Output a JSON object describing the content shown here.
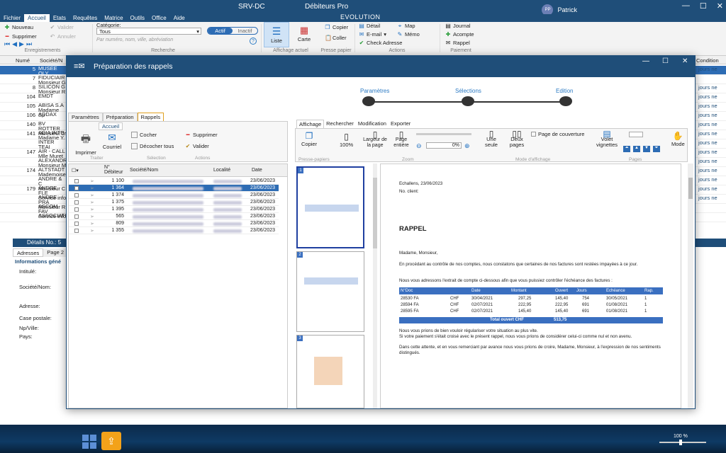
{
  "window": {
    "server": "SRV-DC",
    "app_title": "Débiteurs Pro",
    "subtitle": "EVOLUTION",
    "user_initials": "PP",
    "user_name": "Patrick"
  },
  "menu": [
    "Fichier",
    "Accueil",
    "Etats",
    "Requêtes",
    "Matrice",
    "Outils",
    "Office",
    "Aide"
  ],
  "ribbon": {
    "nouveau": "Nouveau",
    "valider": "Valider",
    "supprimer": "Supprimer",
    "annuler": "Annuler",
    "categorie_label": "Catégorie:",
    "categorie_value": "Tous",
    "search_placeholder": "Par numéro, nom, ville, abréviation",
    "actif": "Actif",
    "inactif": "Inactif",
    "liste": "Liste",
    "carte": "Carte",
    "copier": "Copier",
    "coller": "Coller",
    "detail": "Détail",
    "email": "E-mail",
    "check": "Check Adresse",
    "map": "Map",
    "memo": "Mémo",
    "journal": "Journal",
    "acompte": "Acompte",
    "rappel": "Rappel",
    "groups": {
      "enregistrements": "Enregistrements",
      "recherche": "Recherche",
      "affichage": "Affichage actuel",
      "presse": "Presse papier",
      "actions": "Actions",
      "paiement": "Paiement"
    }
  },
  "grid": {
    "col_num": "Numé",
    "col_soc": "Société/N",
    "col_cond": "Condition",
    "rows": [
      {
        "n": "5",
        "s1": "MUSEE OLY",
        "s2": "Monsieur B",
        "c": "jours ne"
      },
      {
        "n": "7",
        "s1": "FIDUCIAIR",
        "s2": "Monsieur G",
        "c": ""
      },
      {
        "n": "8",
        "s1": "SILICON G",
        "s2": "Monsieur R",
        "c": "jours ne"
      },
      {
        "n": "104",
        "s1": "EMDT",
        "s2": "",
        "c": "jours ne"
      },
      {
        "n": "105",
        "s1": "ABISA S.A",
        "s2": "Madame Sp",
        "c": "jours ne"
      },
      {
        "n": "106",
        "s1": "ADDAX",
        "s2": "",
        "c": "jours ne"
      },
      {
        "n": "140",
        "s1": "BV ROTTER",
        "s2": "Monsieur Jr",
        "c": "jours ne"
      },
      {
        "n": "141",
        "s1": "ADIA INTE",
        "s2": "Madame Y.",
        "c": "jours ne"
      },
      {
        "n": "",
        "s1": "INTER TEAI",
        "s2": "",
        "c": "jours ne"
      },
      {
        "n": "147",
        "s1": "AIR - CALL",
        "s2": "Mlle Muret",
        "c": "jours ne"
      },
      {
        "n": "",
        "s1": "ALEXANDRI",
        "s2": "Monsieur M",
        "c": "jours ne"
      },
      {
        "n": "174",
        "s1": "ALTSTADT",
        "s2": "Mademoise",
        "c": "jours ne"
      },
      {
        "n": "",
        "s1": "ANDRE & C",
        "s2": "Monsieur C",
        "c": "jours ne"
      },
      {
        "n": "179",
        "s1": "ANDRE FLE",
        "s2": "Service info",
        "c": "jours ne"
      },
      {
        "n": "",
        "s1": "ANDRE PRA",
        "s2": "Monsieur R",
        "c": "jours ne"
      },
      {
        "n": "",
        "s1": "ASCOM FAV",
        "s2": "Service info",
        "c": ""
      },
      {
        "n": "",
        "s1": "ASSOCIATI",
        "s2": "",
        "c": ""
      }
    ]
  },
  "details": {
    "title": "Détails No.: 5",
    "tab1": "Adresses",
    "tab2": "Page 2",
    "section": "Informations géné",
    "f1": "Intitulé:",
    "f2": "Société/Nom:",
    "f3": "Adresse:",
    "f4": "Case postale:",
    "f5": "Np/Ville:",
    "f6": "Pays:"
  },
  "modal": {
    "title": "Préparation des rappels",
    "steps": [
      "Paramètres",
      "Sélections",
      "Edition"
    ],
    "left_tabs": [
      "Paramètres",
      "Préparation",
      "Rappels"
    ],
    "sub_tab": "Accueil",
    "imprimer": "Imprimer",
    "courriel": "Courriel",
    "cocher": "Cocher",
    "decocher": "Décocher tous",
    "supprimer": "Supprimer",
    "valider": "Valider",
    "g_traiter": "Traiter",
    "g_selection": "Sélection",
    "g_actions": "Actions",
    "cols": [
      "N° Débiteur",
      "Société/Nom",
      "Localité",
      "Date"
    ],
    "rows": [
      {
        "num": "1 100",
        "date": "23/06/2023"
      },
      {
        "num": "1 364",
        "date": "23/06/2023"
      },
      {
        "num": "1 374",
        "date": "23/06/2023"
      },
      {
        "num": "1 375",
        "date": "23/06/2023"
      },
      {
        "num": "1 395",
        "date": "23/06/2023"
      },
      {
        "num": "565",
        "date": "23/06/2023"
      },
      {
        "num": "809",
        "date": "23/06/2023"
      },
      {
        "num": "1 355",
        "date": "23/06/2023"
      }
    ],
    "right_tabs": [
      "Affichage",
      "Rechercher",
      "Modification",
      "Exporter"
    ],
    "tb": {
      "copier": "Copier",
      "zoom100": "100%",
      "largeur": "Largeur de la page",
      "entiere": "Page entière",
      "pct": "0%",
      "une": "Une seule",
      "deux": "Deux pages",
      "couverture": "Page de couverture",
      "volet": "Volet vignettes",
      "mode": "Mode",
      "g_presse": "Presse-papiers",
      "g_zoom": "Zoom",
      "g_mode": "Mode d'affichage",
      "g_pages": "Pages"
    },
    "doc": {
      "place": "Echallens, 23/06/2023",
      "client": "No. client:",
      "heading": "RAPPEL",
      "salut": "Madame, Monsieur,",
      "p1": "En procédant au contrôle de nos comptes, nous constatons que certaines de nos factures sont restées impayées à ce jour.",
      "p2": "Nous vous adressons l'extrait de compte ci-dessous afin que vous puissiez contrôler l'échéance des factures :",
      "thead": [
        "N°Doc",
        "Date",
        "Montant",
        "Ouvert",
        "Jours",
        "Echéance",
        "Rap."
      ],
      "lines": [
        [
          "28530 FA",
          "CHF",
          "30/04/2021",
          "297,25",
          "145,40",
          "754",
          "30/05/2021",
          "1"
        ],
        [
          "28594 FA",
          "CHF",
          "02/07/2021",
          "222,95",
          "222,95",
          "691",
          "01/08/2021",
          "1"
        ],
        [
          "28595 FA",
          "CHF",
          "02/07/2021",
          "145,40",
          "145,40",
          "691",
          "01/08/2021",
          "1"
        ]
      ],
      "total_label": "Total ouvert CHF",
      "total": "513,75",
      "p3": "Nous vous prions de bien vouloir régulariser votre situation au plus vite.",
      "p4": "Si votre paiement s'était croisé avec le présent rappel, nous vous prions de considérer celui-ci comme nul et non avenu.",
      "p5": "Dans cette attente, et en vous remerciant par avance nous vous prions de croire, Madame, Monsieur, à l'expression de nos sentiments distingués."
    }
  },
  "zoom": "100 %",
  "colors": {
    "primary": "#1f4e79",
    "accent": "#2d6cb4",
    "step": "#2d7bc4"
  }
}
